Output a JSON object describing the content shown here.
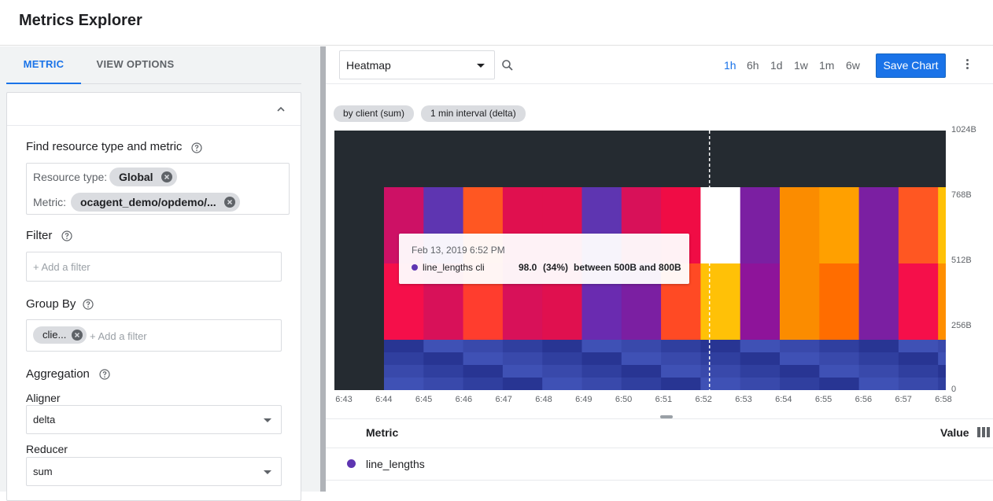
{
  "app": {
    "title": "Metrics Explorer"
  },
  "left_tabs": [
    {
      "label": "METRIC",
      "active": true
    },
    {
      "label": "VIEW OPTIONS",
      "active": false
    }
  ],
  "find_section": {
    "label": "Find resource type and metric",
    "resource_type_label": "Resource type:",
    "resource_type_value": "Global",
    "metric_label": "Metric:",
    "metric_value": "ocagent_demo/opdemo/..."
  },
  "filter": {
    "label": "Filter",
    "placeholder": "+ Add a filter"
  },
  "group_by": {
    "label": "Group By",
    "chip": "clie...",
    "placeholder": "+ Add a filter"
  },
  "aggregation": {
    "label": "Aggregation",
    "aligner_label": "Aligner",
    "aligner_value": "delta",
    "reducer_label": "Reducer",
    "reducer_value": "sum"
  },
  "toolbar": {
    "chart_type": "Heatmap",
    "time_ranges": [
      {
        "label": "1h",
        "active": true
      },
      {
        "label": "6h",
        "active": false
      },
      {
        "label": "1d",
        "active": false
      },
      {
        "label": "1w",
        "active": false
      },
      {
        "label": "1m",
        "active": false
      },
      {
        "label": "6w",
        "active": false
      }
    ],
    "save_label": "Save Chart"
  },
  "chart_pills": [
    "by client (sum)",
    "1 min interval (delta)"
  ],
  "chart_data": {
    "type": "heatmap",
    "x": [
      "6:43",
      "6:44",
      "6:45",
      "6:46",
      "6:47",
      "6:48",
      "6:49",
      "6:50",
      "6:51",
      "6:52",
      "6:53",
      "6:54",
      "6:55",
      "6:56",
      "6:57",
      "6:58"
    ],
    "y_ticks": [
      "1024B",
      "768B",
      "512B",
      "256B",
      "0"
    ],
    "cursor_time": "6:52",
    "colors": {
      "background": "#252b31",
      "upper": [
        "#cd1165",
        "#5e35b1",
        "#ff5722",
        "#e0104f",
        "#e0104f",
        "#5e35b1",
        "#d81159",
        "#f00c45",
        "#ffffff",
        "#7b1fa2",
        "#fb8c00",
        "#ffa000",
        "#7b1fa2",
        "#ff5722",
        "#ffc107"
      ],
      "middle": [
        "#f50f4a",
        "#d81159",
        "#ff3d2e",
        "#d81159",
        "#e0104f",
        "#6a2bb0",
        "#7b1fa2",
        "#ff4a24",
        "#ffc107",
        "#8e149a",
        "#fb8c00",
        "#ff6d00",
        "#7b1fa2",
        "#f50f4a",
        "#ff8f00"
      ],
      "low_band": [
        "#283593",
        "#303f9f",
        "#3949ab",
        "#3f51b5"
      ]
    }
  },
  "tooltip": {
    "time": "Feb 13, 2019 6:52 PM",
    "series": "line_lengths cli",
    "value": "98.0",
    "percent": "(34%)",
    "range": "between 500B and 800B",
    "dot_color": "#5e35b1"
  },
  "legend": {
    "metric_header": "Metric",
    "value_header": "Value",
    "rows": [
      {
        "name": "line_lengths",
        "color": "#5e35b1"
      }
    ]
  }
}
